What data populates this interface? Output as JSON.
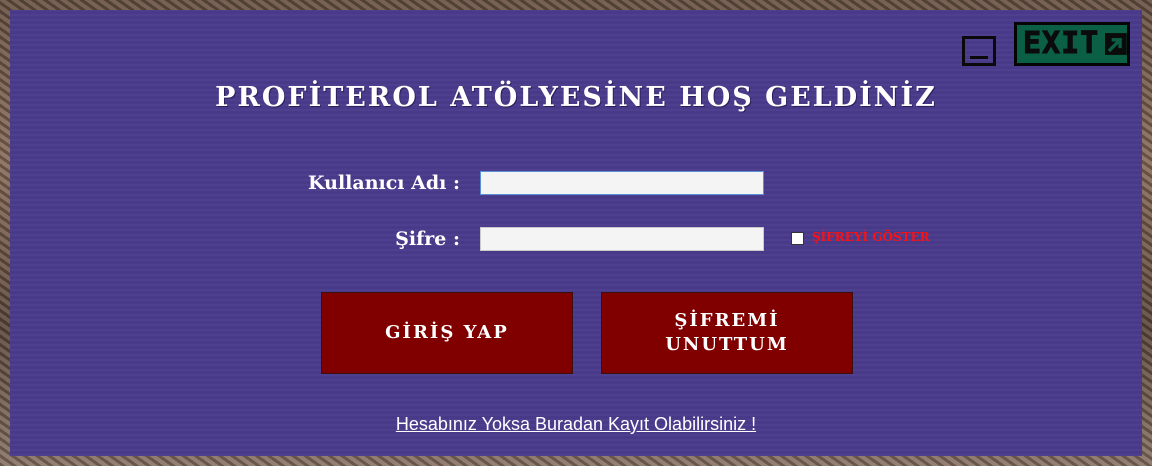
{
  "window": {
    "exit_label": "EXIT",
    "minimize_icon": "minimize-icon",
    "exit_icon": "exit-arrow-icon"
  },
  "login": {
    "title": "PROFİTEROL ATÖLYESİNE HOŞ GELDİNİZ",
    "username_label": "Kullanıcı Adı  :",
    "username_value": "",
    "password_label": "Şifre  :",
    "password_value": "",
    "show_password_label": "ŞİFREYİ GÖSTER",
    "show_password_checked": false,
    "login_button": "GİRİŞ YAP",
    "forgot_button": "ŞİFREMİ UNUTTUM",
    "register_link": "Hesabınız Yoksa Buradan Kayıt Olabilirsiniz ! "
  },
  "colors": {
    "panel_bg": "#4a3b8c",
    "button_bg": "#800000",
    "exit_bg": "#0b5f45",
    "show_password_text": "#ff1010"
  }
}
